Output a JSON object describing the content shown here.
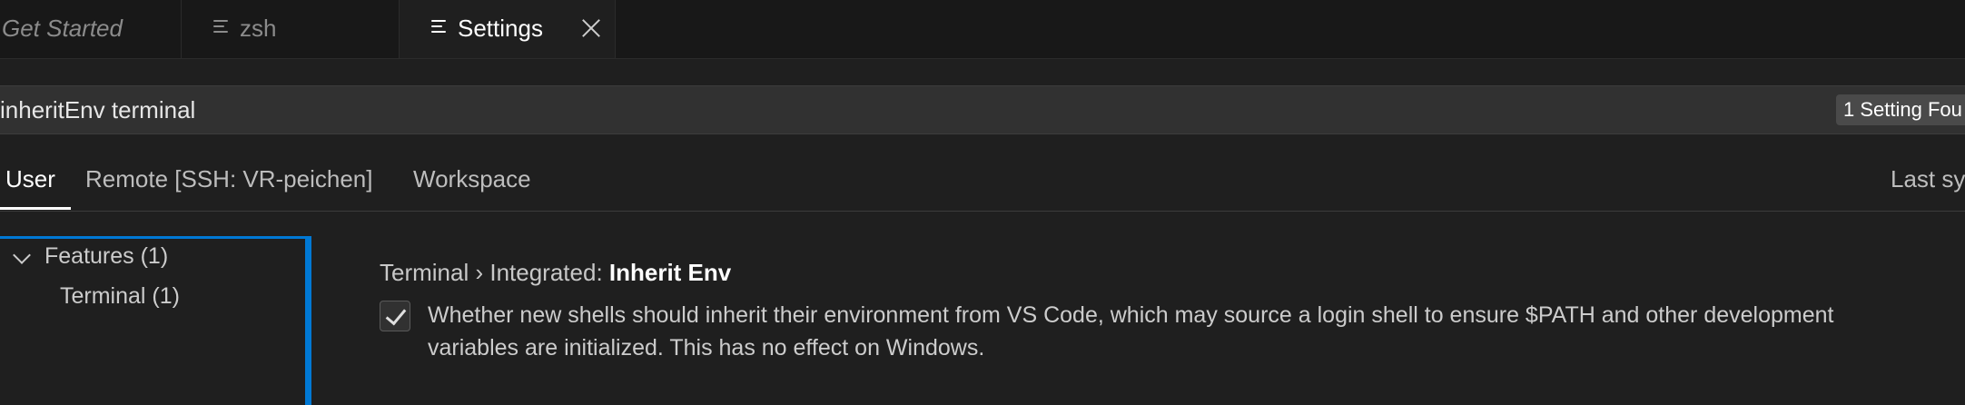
{
  "tabs": [
    {
      "label": "Get Started",
      "icon": "none"
    },
    {
      "label": "zsh",
      "icon": "lines-icon"
    },
    {
      "label": "Settings",
      "icon": "lines-icon",
      "active": true
    }
  ],
  "search": {
    "value": "inheritEnv terminal",
    "found_badge": "1 Setting Fou"
  },
  "scope_tabs": {
    "user": "User",
    "remote": "Remote [SSH: VR-peichen]",
    "workspace": "Workspace",
    "last_sync": "Last sy"
  },
  "toc": {
    "features": "Features (1)",
    "terminal": "Terminal (1)"
  },
  "setting": {
    "title_prefix": "Terminal › Integrated: ",
    "title_name": "Inherit Env",
    "checked": true,
    "desc_line1": "Whether new shells should inherit their environment from VS Code, which may source a login shell to ensure $PATH and other development",
    "desc_line2": "variables are initialized. This has no effect on Windows."
  },
  "colors": {
    "accent": "#0078d4",
    "background": "#1f1f1f"
  }
}
